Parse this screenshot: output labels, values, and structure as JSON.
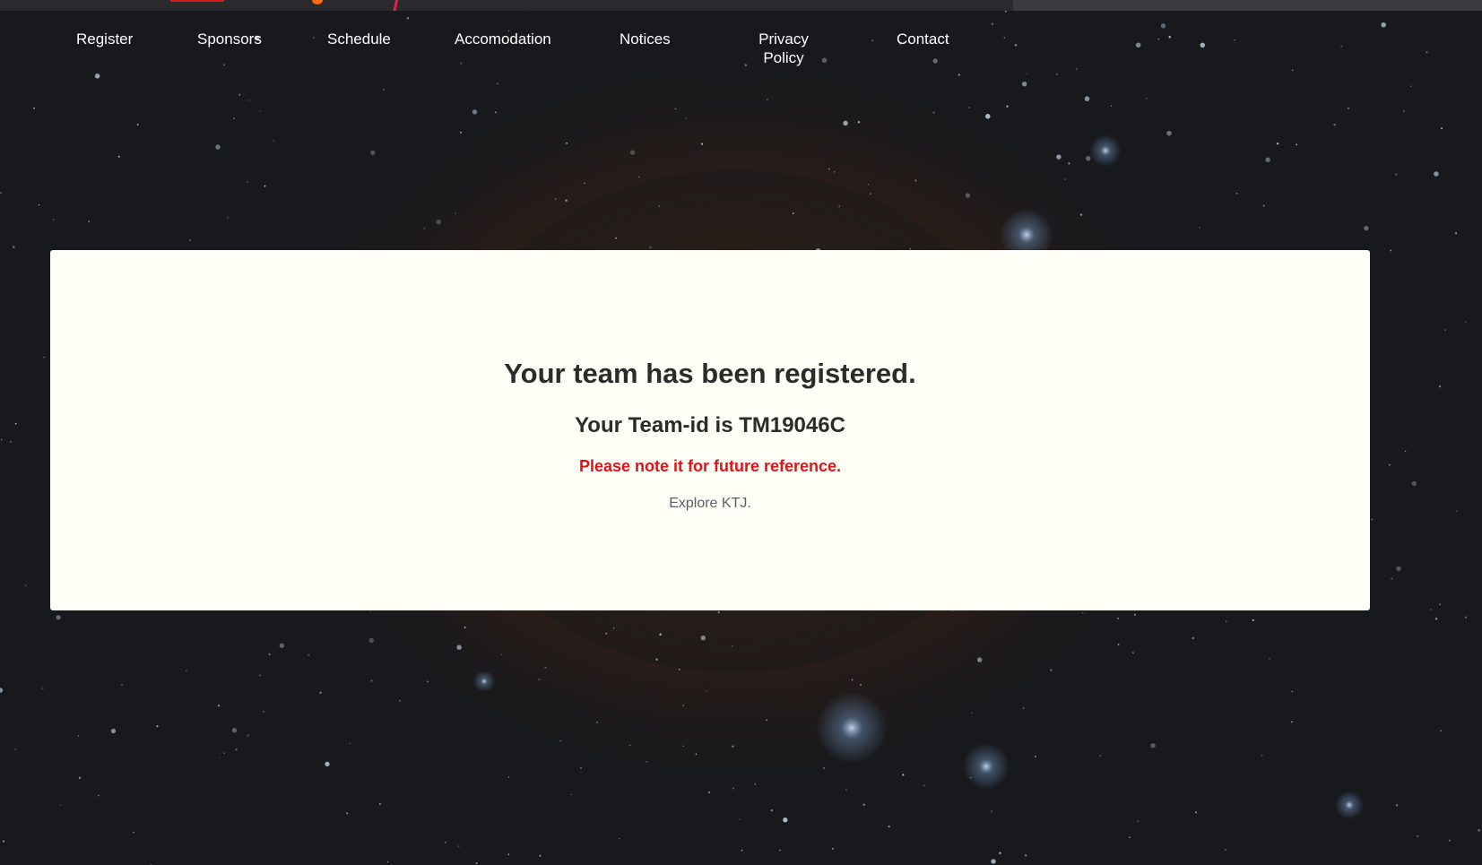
{
  "nav": {
    "items": [
      {
        "label": "Register"
      },
      {
        "label": "Sponsors"
      },
      {
        "label": "Schedule"
      },
      {
        "label": "Accomodation"
      },
      {
        "label": "Notices"
      },
      {
        "label": "Privacy Policy"
      },
      {
        "label": "Contact"
      }
    ]
  },
  "confirmation": {
    "heading": "Your team has been registered.",
    "team_id_text": "Your Team-id is TM19046C",
    "note": "Please note it for future reference.",
    "explore_link": "Explore KTJ."
  },
  "colors": {
    "card_background": "#fefef6",
    "heading_text": "#2b2b2b",
    "note_text": "#e0121a",
    "explore_text": "#5a6068",
    "nav_text": "#ffffff"
  },
  "icons": [
    "starfield-background"
  ]
}
